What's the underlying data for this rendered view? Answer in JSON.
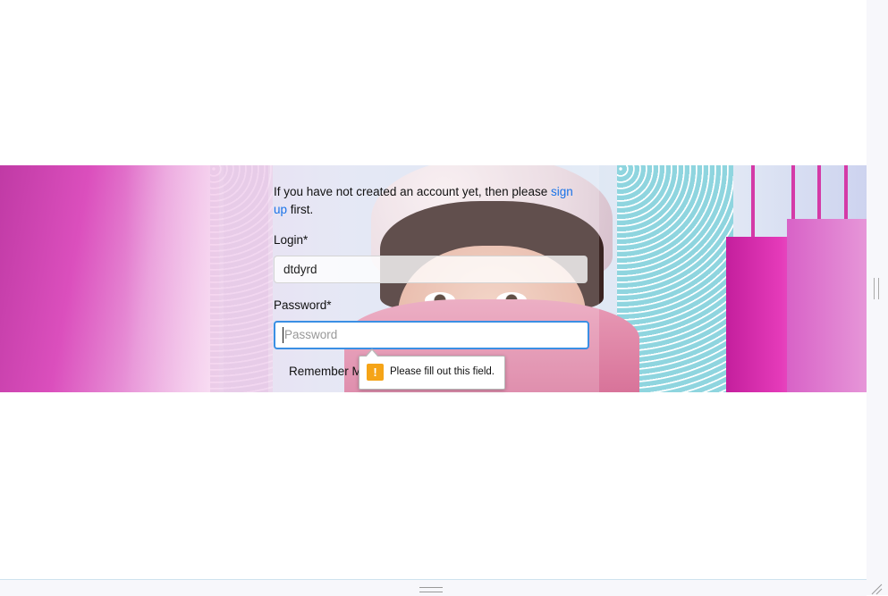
{
  "form": {
    "intro_prefix": "If you have not created an account yet, then please ",
    "signup_link": "sign up",
    "intro_suffix": " first.",
    "login_label": "Login*",
    "login_value": "dtdyrd",
    "password_label": "Password*",
    "password_placeholder": "Password",
    "remember_label": "Remember Me"
  },
  "validation": {
    "message": "Please fill out this field.",
    "icon": "warning-icon"
  },
  "colors": {
    "link": "#1a73e8",
    "focus_border": "#3a8fe4",
    "warning": "#f5a417"
  }
}
